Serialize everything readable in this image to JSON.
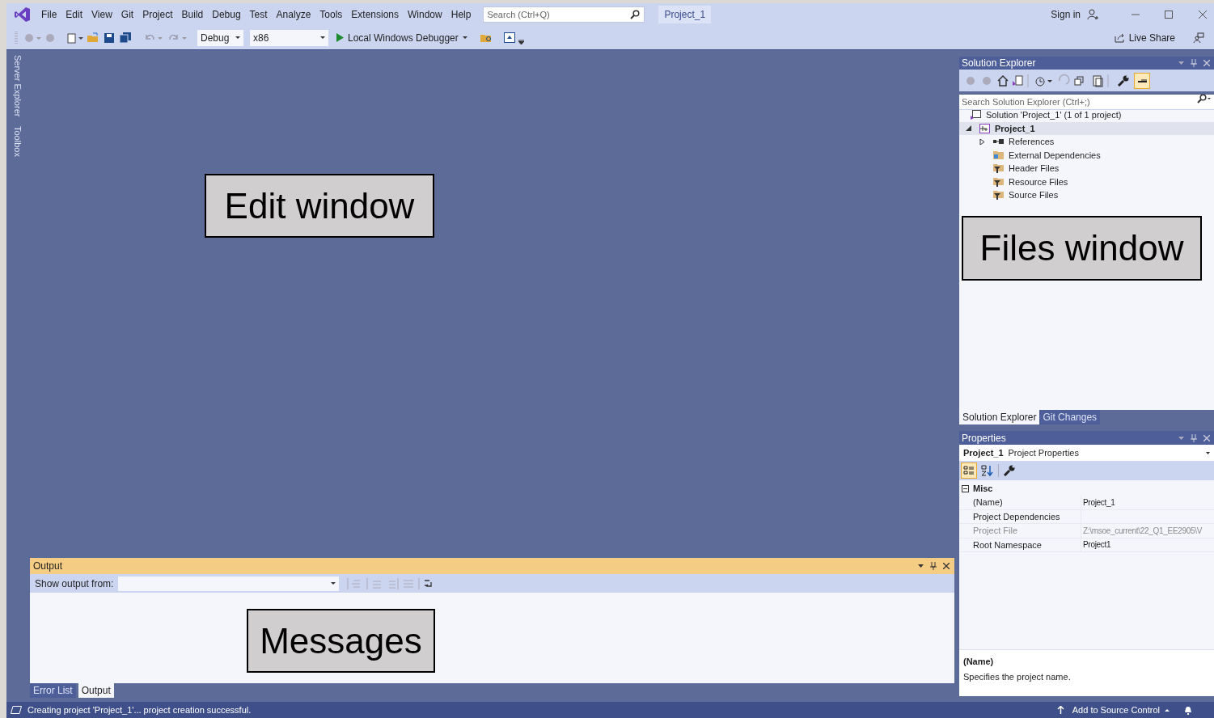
{
  "title_bar": {
    "menu": [
      "File",
      "Edit",
      "View",
      "Git",
      "Project",
      "Build",
      "Debug",
      "Test",
      "Analyze",
      "Tools",
      "Extensions",
      "Window",
      "Help"
    ],
    "search": {
      "placeholder": "Search (Ctrl+Q)"
    },
    "solution_name": "Project_1",
    "sign_in": "Sign in"
  },
  "toolbar": {
    "configuration": "Debug",
    "platform": "x86",
    "run_target": "Local Windows Debugger",
    "live_share": "Live Share"
  },
  "side_tabs": [
    "Server Explorer",
    "Toolbox"
  ],
  "editor": {
    "annotation": "Edit window"
  },
  "solution_explorer": {
    "title": "Solution Explorer",
    "search": {
      "placeholder": "Search Solution Explorer (Ctrl+;)"
    },
    "tree": [
      {
        "label": "Solution 'Project_1' (1 of 1 project)",
        "kind": "solution",
        "selected": false,
        "children": [
          {
            "label": "Project_1",
            "kind": "project",
            "expanded": true,
            "selected": true,
            "children": [
              {
                "label": "References",
                "kind": "references",
                "expanded": false,
                "selected": false
              },
              {
                "label": "External Dependencies",
                "kind": "external",
                "selected": false
              },
              {
                "label": "Header Files",
                "kind": "filter",
                "selected": false
              },
              {
                "label": "Resource Files",
                "kind": "filter",
                "selected": false
              },
              {
                "label": "Source Files",
                "kind": "filter",
                "selected": false
              }
            ]
          }
        ]
      }
    ],
    "annotation": "Files window",
    "tabs": [
      {
        "label": "Solution Explorer",
        "selected": true
      },
      {
        "label": "Git Changes",
        "selected": false
      }
    ]
  },
  "properties": {
    "title": "Properties",
    "object": "Project_1",
    "object_type": "Project Properties",
    "category": "Misc",
    "expanded": true,
    "rows": [
      {
        "name": "(Name)",
        "value": "Project_1",
        "disabled": false
      },
      {
        "name": "Project Dependencies",
        "value": "",
        "disabled": false
      },
      {
        "name": "Project File",
        "value": "Z:\\msoe_current\\22_Q1_EE2905\\V",
        "disabled": true
      },
      {
        "name": "Root Namespace",
        "value": "Project1",
        "disabled": false
      }
    ],
    "description_title": "(Name)",
    "description": "Specifies the project name."
  },
  "output": {
    "title": "Output",
    "show_output_from": "Show output from:",
    "annotation": "Messages",
    "tabs": [
      {
        "label": "Error List",
        "selected": false
      },
      {
        "label": "Output",
        "selected": true
      }
    ]
  },
  "status_bar": {
    "message": "Creating project 'Project_1'... project creation successful.",
    "source_control": "Add to Source Control"
  }
}
